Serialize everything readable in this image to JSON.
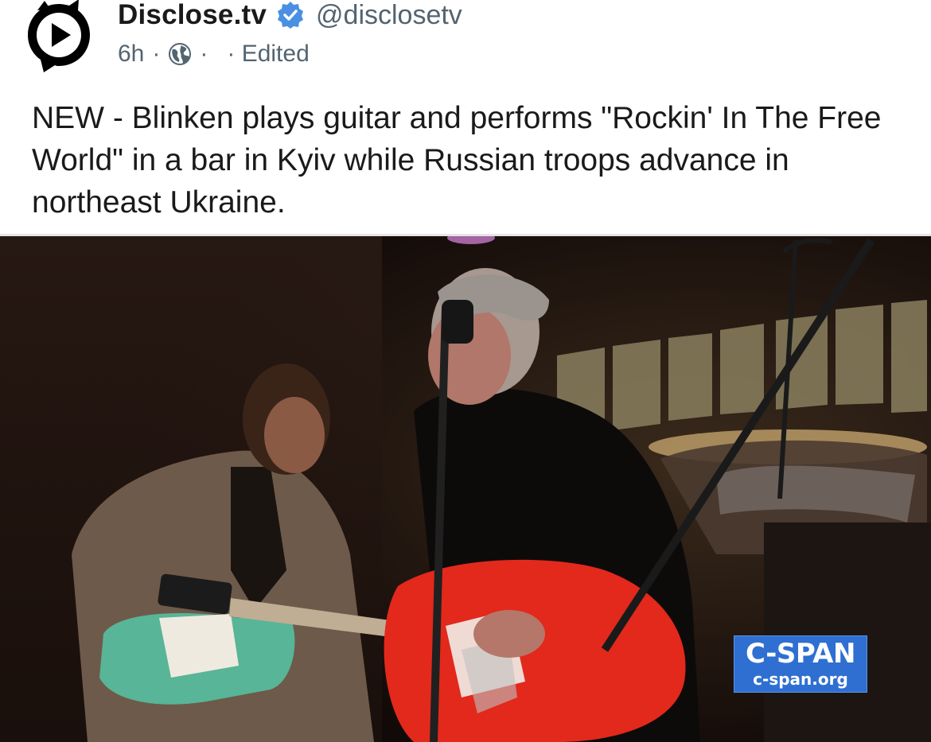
{
  "post": {
    "author": {
      "display_name": "Disclose.tv",
      "handle": "@disclosetv",
      "verified": true,
      "avatar_icon": "play-button-cat-logo"
    },
    "meta": {
      "time": "6h",
      "separator": "·",
      "visibility_icon": "globe-icon",
      "extra_dot": "·",
      "edited_label": "· Edited"
    },
    "text": "NEW - Blinken plays guitar and performs \"Rockin' In The Free World\" in a bar in Kyiv while Russian troops advance in northeast Ukraine.",
    "media": {
      "type": "video-frame",
      "watermark": {
        "title": "C-SPAN",
        "url": "c-span.org"
      }
    }
  },
  "colors": {
    "verified_badge": "#4a90e2",
    "secondary_text": "#536471",
    "cspan_blue": "#2f6fd1"
  }
}
